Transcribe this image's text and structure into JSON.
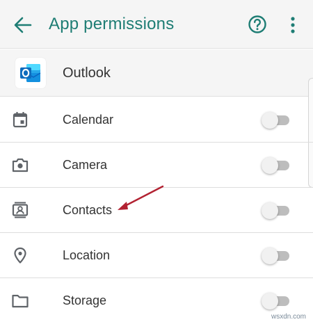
{
  "header": {
    "title": "App permissions",
    "back_icon": "arrow-left-icon",
    "help_icon": "help-circle-icon",
    "more_icon": "more-vert-icon",
    "accent_color": "#1e7d74"
  },
  "app": {
    "name": "Outlook",
    "icon": "outlook-logo-icon"
  },
  "permissions": [
    {
      "label": "Calendar",
      "icon": "calendar-icon",
      "enabled": false
    },
    {
      "label": "Camera",
      "icon": "camera-icon",
      "enabled": false
    },
    {
      "label": "Contacts",
      "icon": "contacts-icon",
      "enabled": false
    },
    {
      "label": "Location",
      "icon": "location-pin-icon",
      "enabled": false
    },
    {
      "label": "Storage",
      "icon": "folder-icon",
      "enabled": false
    }
  ],
  "annotation": {
    "color": "#b22232",
    "target": "Contacts"
  },
  "watermark": "wsxdn.com"
}
